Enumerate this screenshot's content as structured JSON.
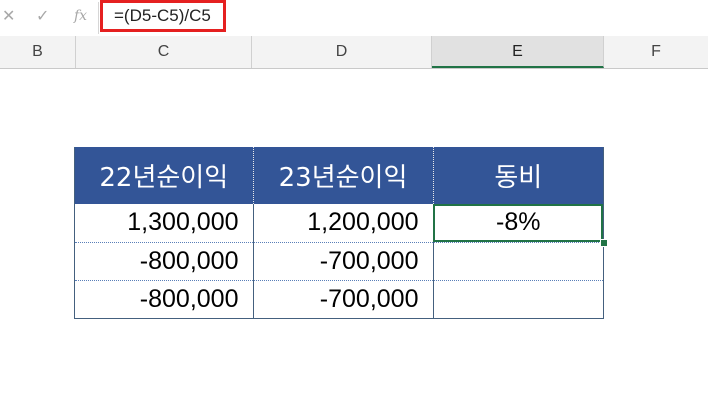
{
  "formula_bar": {
    "cancel_icon": "close-icon",
    "enter_icon": "check-icon",
    "fx_label": "fx",
    "formula": "=(D5-C5)/C5"
  },
  "columns": [
    "B",
    "C",
    "D",
    "E",
    "F"
  ],
  "selected_column": "E",
  "table": {
    "headers": [
      "22년순이익",
      "23년순이익",
      "동비"
    ],
    "rows": [
      {
        "c": "1,300,000",
        "d": "1,200,000",
        "e": "-8%"
      },
      {
        "c": "-800,000",
        "d": "-700,000",
        "e": ""
      },
      {
        "c": "-800,000",
        "d": "-700,000",
        "e": ""
      }
    ]
  },
  "colors": {
    "header_fill": "#335597",
    "selection_green": "#217346",
    "highlight_red": "#e52020"
  }
}
